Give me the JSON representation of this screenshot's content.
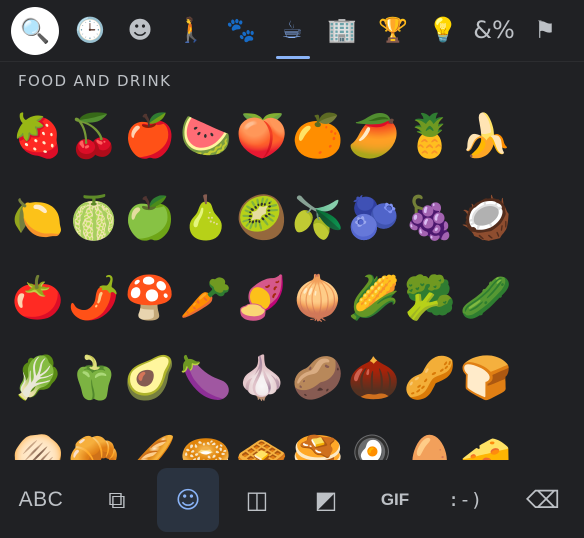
{
  "categories": [
    {
      "name": "search-icon",
      "glyph": "🔍"
    },
    {
      "name": "recent-icon",
      "glyph": "🕒"
    },
    {
      "name": "smileys-icon",
      "glyph": "☻"
    },
    {
      "name": "people-icon",
      "glyph": "🚶"
    },
    {
      "name": "animals-nature-icon",
      "glyph": "🐾"
    },
    {
      "name": "food-drink-icon",
      "glyph": "☕"
    },
    {
      "name": "travel-places-icon",
      "glyph": "🏢"
    },
    {
      "name": "activities-icon",
      "glyph": "🏆"
    },
    {
      "name": "objects-icon",
      "glyph": "💡"
    },
    {
      "name": "symbols-icon",
      "glyph": "&%"
    },
    {
      "name": "flags-icon",
      "glyph": "⚑"
    }
  ],
  "active_category": "food-drink-icon",
  "section_title": "FOOD AND DRINK",
  "emoji_rows": [
    [
      "🍓",
      "🍒",
      "🍎",
      "🍉",
      "🍑",
      "🍊",
      "🥭",
      "🍍",
      "🍌"
    ],
    [
      "🍋",
      "🍈",
      "🍏",
      "🍐",
      "🥝",
      "🫒",
      "🫐",
      "🍇",
      "🥥"
    ],
    [
      "🍅",
      "🌶️",
      "🍄",
      "🥕",
      "🍠",
      "🧅",
      "🌽",
      "🥦",
      "🥒"
    ],
    [
      "🥬",
      "🫑",
      "🥑",
      "🍆",
      "🧄",
      "🥔",
      "🌰",
      "🥜",
      "🍞"
    ],
    [
      "🫓",
      "🥐",
      "🥖",
      "🥯",
      "🧇",
      "🥞",
      "🍳",
      "🥚",
      "🧀"
    ]
  ],
  "bottom_bar": {
    "abc_label": "ABC",
    "sticker_search_glyph": "⧉",
    "emoji_glyph": "☺",
    "sticker_glyph": "◫",
    "bitmoji_glyph": "◩",
    "gif_label": "GIF",
    "emoticon_label": ":-)",
    "backspace_glyph": "⌫"
  },
  "colors": {
    "background": "#202124",
    "accent": "#8ab4f8",
    "icon": "#bdc1c6"
  }
}
